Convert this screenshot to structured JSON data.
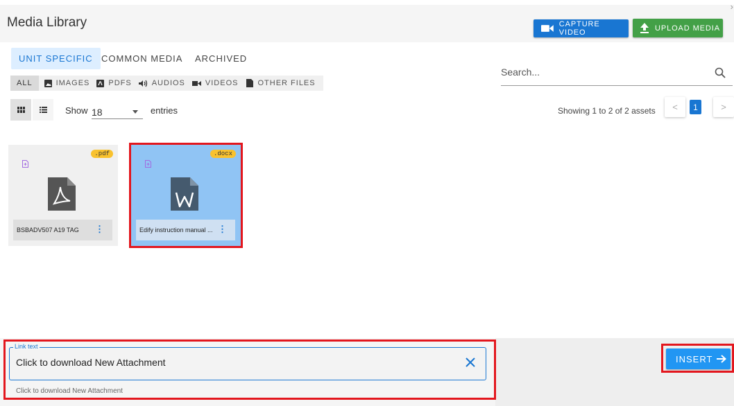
{
  "header": {
    "title": "Media Library",
    "close_glyph": "›",
    "capture_label": "CAPTURE VIDEO",
    "upload_label": "UPLOAD MEDIA"
  },
  "source_tabs": [
    {
      "label": "UNIT SPECIFIC",
      "active": true
    },
    {
      "label": "COMMON MEDIA",
      "active": false
    },
    {
      "label": "ARCHIVED",
      "active": false
    }
  ],
  "filters": [
    {
      "label": "ALL",
      "icon": "none",
      "active": true
    },
    {
      "label": "IMAGES",
      "icon": "image-icon",
      "active": false
    },
    {
      "label": "PDFS",
      "icon": "pdf-icon",
      "active": false
    },
    {
      "label": "AUDIOS",
      "icon": "speaker-icon",
      "active": false
    },
    {
      "label": "VIDEOS",
      "icon": "video-camera-icon",
      "active": false
    },
    {
      "label": "OTHER FILES",
      "icon": "file-icon",
      "active": false
    }
  ],
  "view": {
    "active": "grid"
  },
  "show": {
    "label": "Show",
    "value": "18",
    "suffix": "entries"
  },
  "search": {
    "placeholder": "Search..."
  },
  "pagination": {
    "summary": "Showing 1 to 2 of 2 assets",
    "prev": "<",
    "current": "1",
    "next": ">"
  },
  "assets": [
    {
      "name": "BSBADV507 A19 TAG",
      "ext": ".pdf",
      "icon": "pdf-file-icon",
      "selected": false
    },
    {
      "name": "Edify instruction manual ...",
      "ext": ".docx",
      "icon": "word-file-icon",
      "selected": true
    }
  ],
  "link_text": {
    "legend": "Link text",
    "value": "Click to download New Attachment",
    "helper": "Click to download New Attachment"
  },
  "insert": {
    "label": "INSERT"
  },
  "colors": {
    "primary": "#1976d2",
    "success": "#43a047",
    "selected_card": "#90c4f4",
    "badge": "#f9c22e",
    "highlight": "#e3161d"
  }
}
